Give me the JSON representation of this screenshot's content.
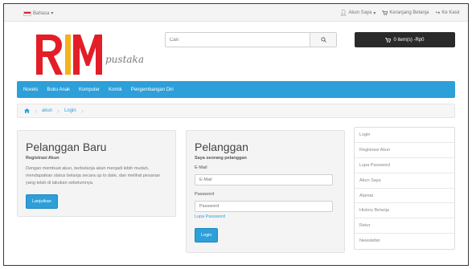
{
  "topbar": {
    "language_label": "Bahasa",
    "account_label": "Akun Saya",
    "cart_link_label": "Keranjang Belanja",
    "checkout_label": "Ke Kasir"
  },
  "header": {
    "logo_text": "pustaka",
    "search_placeholder": "Cari",
    "cart_button_label": "0 item(s) -Rp0"
  },
  "nav": {
    "items": [
      "Novels",
      "Buku Anak",
      "Komputer",
      "Komik",
      "Pengembangan Diri"
    ]
  },
  "breadcrumb": {
    "items": [
      "akun",
      "Login"
    ]
  },
  "new_customer": {
    "title": "Pelanggan Baru",
    "subtitle": "Registrasi Akun",
    "text": "Dengan membuat akun, berbelanja akan menjadi lebih mudah, mendapatkan status belanja secara up to date, dan melihat pesanan yang telah di lakukan sebelumnya.",
    "continue_label": "Lanjutkan"
  },
  "returning_customer": {
    "title": "Pelanggan",
    "subtitle": "Saya seorang pelanggan",
    "email_label": "E-Mail",
    "email_placeholder": "E-Mail",
    "password_label": "Password",
    "password_placeholder": "Password",
    "forgot_label": "Lupa Password",
    "login_label": "Login"
  },
  "sidebar": {
    "items": [
      "Login",
      "Registrasi Akun",
      "Lupa Password",
      "Akun Saya",
      "Alamat",
      "History Belanja",
      "Retur",
      "Newsletter"
    ]
  },
  "colors": {
    "accent": "#2d9fd9",
    "cart_bg": "#2a2a2a",
    "logo_red": "#e31e27"
  }
}
